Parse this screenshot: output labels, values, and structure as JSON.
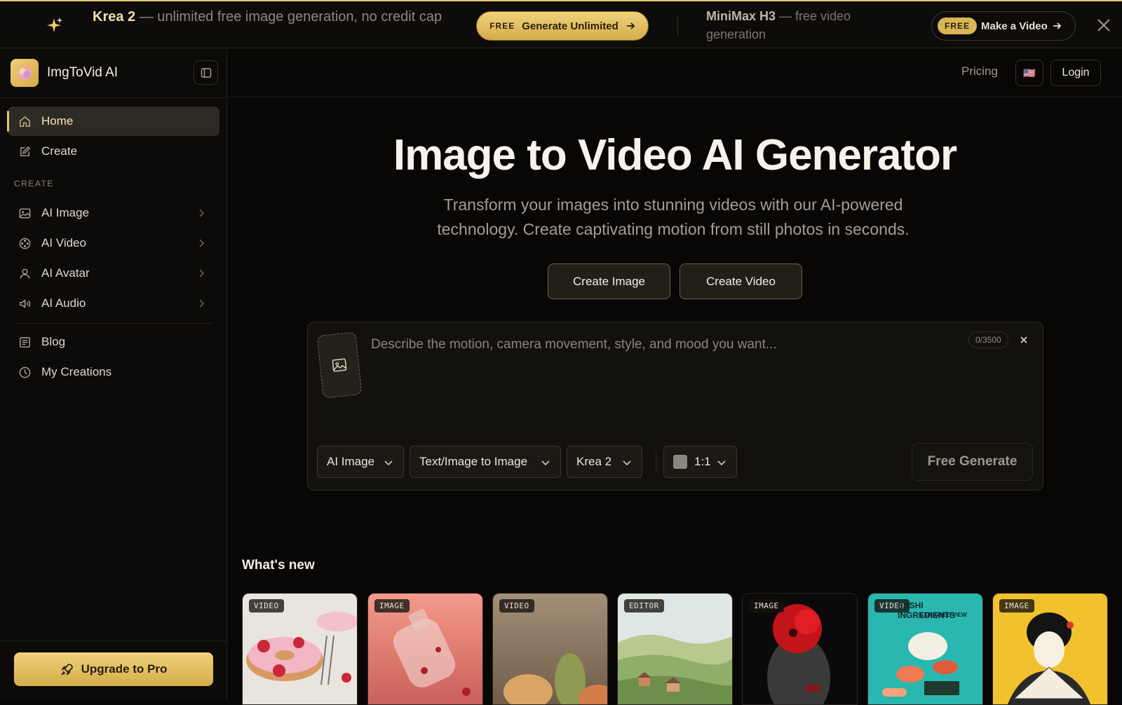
{
  "banner": {
    "promo1_title": "Krea 2",
    "promo1_rest": " — unlimited free image generation, no credit cap",
    "promo1_badge": "FREE",
    "promo1_button": "Generate Unlimited",
    "promo2_title": "MiniMax H3",
    "promo2_rest": " — free video generation",
    "promo2_badge": "FREE",
    "promo2_button": "Make a Video"
  },
  "sidebar": {
    "brand": "ImgToVid AI",
    "nav_home": "Home",
    "nav_create": "Create",
    "section_label": "CREATE",
    "items": [
      "AI Image",
      "AI Video",
      "AI Avatar",
      "AI Audio"
    ],
    "blog": "Blog",
    "my_creations": "My Creations",
    "upgrade": "Upgrade to Pro"
  },
  "header": {
    "pricing": "Pricing",
    "flag": "🇺🇸",
    "login": "Login"
  },
  "hero": {
    "title": "Image to Video AI Generator",
    "subtitle": "Transform your images into stunning videos with our AI-powered technology. Create captivating motion from still photos in seconds.",
    "btn_image": "Create Image",
    "btn_video": "Create Video"
  },
  "prompt": {
    "placeholder": "Describe the motion, camera movement, style, and mood you want...",
    "counter": "0/3500",
    "clear": "×",
    "mode": "AI Image",
    "type": "Text/Image to Image",
    "model": "Krea 2",
    "ratio": "1:1",
    "generate": "Free Generate"
  },
  "whats_new": {
    "title": "What's new",
    "cards": [
      {
        "tag": "VIDEO"
      },
      {
        "tag": "IMAGE"
      },
      {
        "tag": "VIDEO"
      },
      {
        "tag": "EDITOR"
      },
      {
        "tag": "IMAGE"
      },
      {
        "tag": "VIDEO",
        "text1": "SUSHI INGREDIENTS",
        "text2": "EXPLODED VIEW"
      },
      {
        "tag": "IMAGE"
      }
    ]
  },
  "colors": {
    "accent": "#e3c46a",
    "background": "#080706",
    "sidebar": "#0c0b09"
  }
}
